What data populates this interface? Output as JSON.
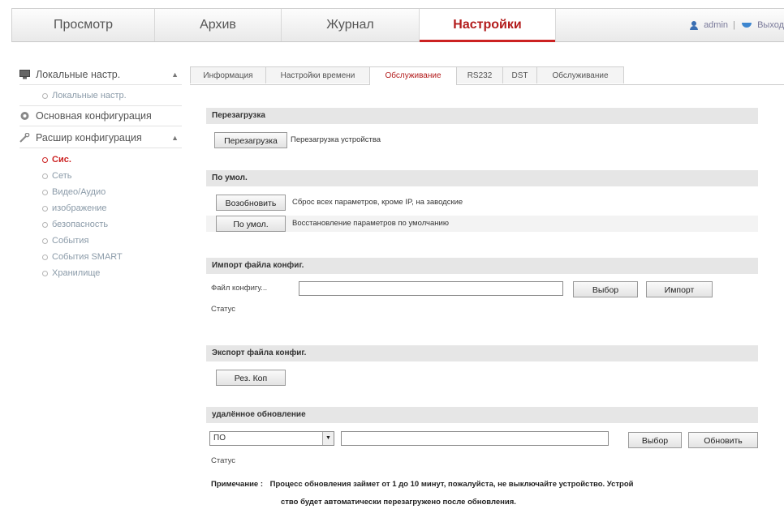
{
  "nav": {
    "tabs": [
      {
        "label": "Просмотр"
      },
      {
        "label": "Архив"
      },
      {
        "label": "Журнал"
      },
      {
        "label": "Настройки"
      }
    ],
    "user": "admin",
    "separator": "|",
    "logout": "Выход"
  },
  "sidebar": {
    "local": {
      "label": "Локальные настр.",
      "items": [
        {
          "label": "Локальные настр."
        }
      ]
    },
    "basic": {
      "label": "Основная конфигурация"
    },
    "advanced": {
      "label": "Расшир конфигурация",
      "items": [
        {
          "label": "Сис."
        },
        {
          "label": "Сеть"
        },
        {
          "label": "Видео/Аудио"
        },
        {
          "label": "изображение"
        },
        {
          "label": "безопасность"
        },
        {
          "label": "События"
        },
        {
          "label": "События SMART"
        },
        {
          "label": "Хранилище"
        }
      ]
    }
  },
  "tabs": [
    {
      "label": "Информация"
    },
    {
      "label": "Настройки времени"
    },
    {
      "label": "Обслуживание"
    },
    {
      "label": "RS232"
    },
    {
      "label": "DST"
    },
    {
      "label": "Обслуживание"
    }
  ],
  "reboot": {
    "title": "Перезагрузка",
    "button": "Перезагрузка",
    "desc": "Перезагрузка устройства"
  },
  "defaults": {
    "title": "По умол.",
    "restore_button": "Возобновить",
    "restore_desc": "Сброс всех параметров, кроме IP, на заводские",
    "default_button": "По умол.",
    "default_desc": "Восстановление параметров по умолчанию"
  },
  "import": {
    "title": "Импорт файла конфиг.",
    "file_label": "Файл конфигу...",
    "file_value": "",
    "browse_button": "Выбор",
    "import_button": "Импорт",
    "status_label": "Статус"
  },
  "export": {
    "title": "Экспорт файла конфиг.",
    "button": "Рез. Коп"
  },
  "upgrade": {
    "title": "удалённое обновление",
    "type_value": "ПО",
    "file_value": "",
    "browse_button": "Выбор",
    "upgrade_button": "Обновить",
    "status_label": "Статус",
    "note_label": "Примечание :",
    "note_line1": "Процесс обновления займет от 1 до 10 минут, пожалуйста, не выключайте устройство. Устрой",
    "note_line2": "ство будет автоматически перезагружено после обновления."
  }
}
